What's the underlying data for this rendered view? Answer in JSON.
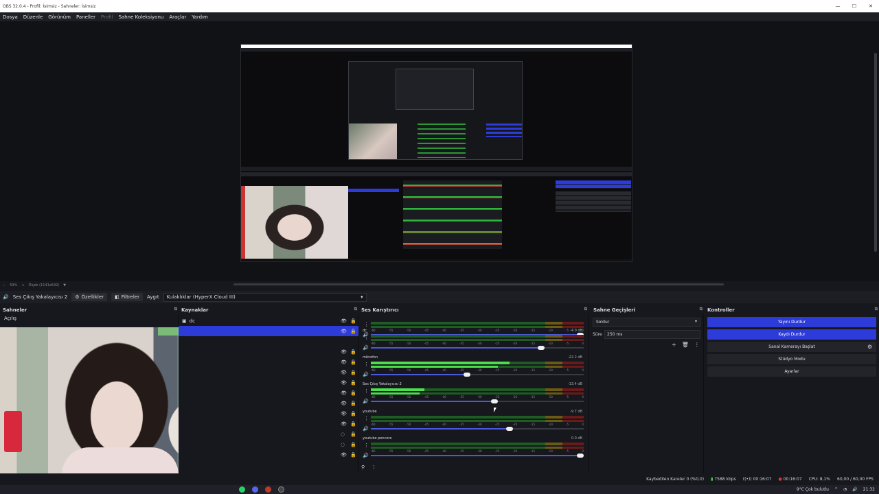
{
  "window": {
    "title": "OBS 32.0.4 - Profil: İsimsiz - Sahneler: İsimsiz",
    "minimize": "—",
    "maximize": "☐",
    "close": "✕"
  },
  "menu": [
    "Dosya",
    "Düzenle",
    "Görünüm",
    "Paneller",
    "Profil",
    "Sahne Koleksiyonu",
    "Araçlar",
    "Yardım"
  ],
  "zoom": {
    "percent": "59%",
    "scale": "Ölçek (1141x642)"
  },
  "source_toolbar": {
    "source_name": "Ses Çıkış Yakalayıcısı 2",
    "properties": "Özellikler",
    "filters": "Filtreler",
    "device_label": "Aygıt",
    "device_value": "Kulaklıklar (HyperX Cloud III)"
  },
  "docks": {
    "scenes": "Sahneler",
    "sources": "Kaynaklar",
    "mixer": "Ses Karıştırıcı",
    "transitions": "Sahne Geçişleri",
    "controls": "Kontroller"
  },
  "scenes": [
    "Açılış"
  ],
  "sources": [
    {
      "name": "dc",
      "icon": "window-icon"
    },
    {
      "name": "",
      "icon": ""
    }
  ],
  "mixer": [
    {
      "name": "",
      "db": "",
      "meter": 0.0,
      "volume": 1.0
    },
    {
      "name": "dc",
      "db": "-4.0 dB",
      "meter": 0.0,
      "volume": 0.8
    },
    {
      "name": "mikrofon",
      "db": "-22.2 dB",
      "meter": 0.65,
      "volume": 0.45
    },
    {
      "name": "Ses Çıkış Yakalayıcısı 2",
      "db": "-13.4 dB",
      "meter": 0.25,
      "volume": 0.58
    },
    {
      "name": "youtube",
      "db": "-9.7 dB",
      "meter": 0.0,
      "volume": 0.65
    },
    {
      "name": "youtube pencere",
      "db": "0.0 dB",
      "meter": 0.0,
      "volume": 1.0
    }
  ],
  "meter_ticks": [
    "-60",
    "-55",
    "-50",
    "-45",
    "-40",
    "-35",
    "-30",
    "-25",
    "-20",
    "-15",
    "-10",
    "-5",
    "0"
  ],
  "transitions": {
    "selected": "Soldur",
    "duration_label": "Süre",
    "duration_value": "250 ms"
  },
  "controls": [
    {
      "label": "Yayını Durdur",
      "active": true
    },
    {
      "label": "Kaydı Durdur",
      "active": true
    },
    {
      "label": "Sanal Kamerayı Başlat",
      "active": false
    },
    {
      "label": "Stüdyo Modu",
      "active": false
    },
    {
      "label": "Ayarlar",
      "active": false
    }
  ],
  "status": {
    "dropped": "Kaybedilen Kareler 0 (%0,0)",
    "bitrate": "7588 kbps",
    "stream_time": "00:16:07",
    "rec_time": "00:16:07",
    "cpu": "CPU: 8,1%",
    "fps": "60,00 / 60,00 FPS"
  },
  "taskbar": {
    "weather": "9°C  Çok bulutlu",
    "clock": "21:32"
  },
  "colors": {
    "accent": "#2d3bd8",
    "meter_green": "#4be04b",
    "rec_red": "#e03a3a"
  }
}
